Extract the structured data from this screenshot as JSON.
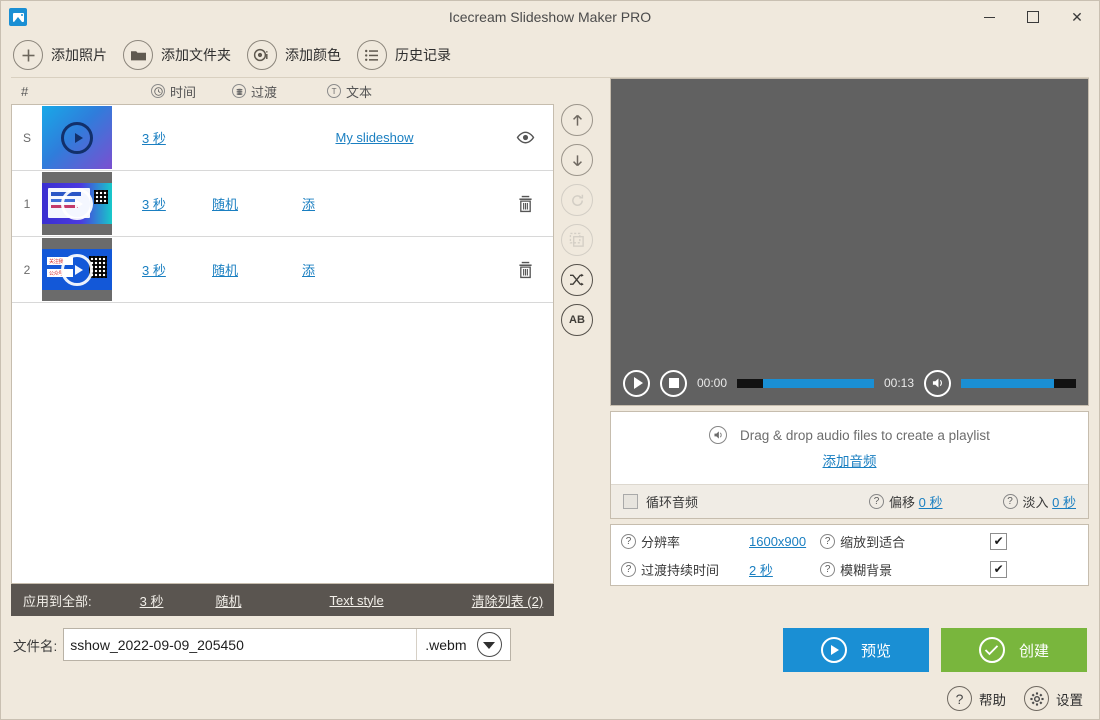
{
  "window": {
    "title": "Icecream Slideshow Maker PRO",
    "app_icon": "picture-icon",
    "minimize": "–",
    "maximize": "□",
    "close": "✕"
  },
  "toolbar": {
    "items": [
      {
        "label": "添加照片",
        "icon": "plus-icon"
      },
      {
        "label": "添加文件夹",
        "icon": "folder-icon"
      },
      {
        "label": "添加颜色",
        "icon": "color-icon"
      },
      {
        "label": "历史记录",
        "icon": "history-list-icon"
      }
    ]
  },
  "list": {
    "headers": {
      "number": "#",
      "time": "时间",
      "time_icon": "clock-icon",
      "transition": "过渡",
      "transition_icon": "transition-icon",
      "text": "文本",
      "text_icon": "text-t-icon"
    },
    "rows": [
      {
        "num": "S",
        "thumb": "gradient-blue-purple",
        "time": "3 秒",
        "transition": "",
        "text": "My slideshow",
        "action": "眼睛",
        "action_icon": "eye-icon"
      },
      {
        "num": "1",
        "thumb": "photo-card-qr",
        "time": "3 秒",
        "transition": "随机",
        "text": "添",
        "action": "删除",
        "action_icon": "trash-icon"
      },
      {
        "num": "2",
        "thumb": "photo-blue-qr",
        "time": "3 秒",
        "transition": "随机",
        "text": "添",
        "action": "删除",
        "action_icon": "trash-icon"
      }
    ]
  },
  "side_tools": [
    {
      "name": "move-up",
      "icon": "arrow-up-icon",
      "state": "enabled"
    },
    {
      "name": "move-down",
      "icon": "arrow-down-icon",
      "state": "enabled"
    },
    {
      "name": "rotate",
      "icon": "rotate-icon",
      "state": "disabled"
    },
    {
      "name": "duplicate",
      "icon": "copy-icon",
      "state": "disabled"
    },
    {
      "name": "shuffle",
      "icon": "shuffle-icon",
      "state": "enabled"
    },
    {
      "name": "sort-ab",
      "icon": "ab-sort-icon",
      "label": "AB",
      "state": "enabled"
    }
  ],
  "apply_all": {
    "label": "应用到全部:",
    "time": "3 秒",
    "transition": "随机",
    "text_style": "Text style",
    "clear_list": "清除列表 (2)"
  },
  "player": {
    "play_icon": "play-icon",
    "stop_icon": "stop-icon",
    "current_time": "00:00",
    "total_time": "00:13",
    "speaker_icon": "speaker-icon",
    "seek_percent": 0,
    "volume_percent": 82
  },
  "audio": {
    "drop_icon": "speaker-icon",
    "drop_text": "Drag & drop audio files to create a playlist",
    "add_audio": "添加音频",
    "loop_label": "循环音频",
    "loop_checked": false,
    "offset_label": "偏移",
    "offset_value": "0 秒",
    "fadein_label": "淡入",
    "fadein_value": "0 秒",
    "help_icon": "question-icon"
  },
  "settings": {
    "resolution_label": "分辨率",
    "resolution_value": "1600x900",
    "transition_duration_label": "过渡持续时间",
    "transition_duration_value": "2 秒",
    "zoom_fit_label": "缩放到适合",
    "zoom_fit_checked": true,
    "blur_bg_label": "模糊背景",
    "blur_bg_checked": true,
    "check_mark": "✔",
    "help_icon": "question-icon"
  },
  "filename": {
    "label": "文件名:",
    "value": "sshow_2022-09-09_205450",
    "placeholder": "sshow",
    "extension": ".webm",
    "dropdown_icon": "chevron-down-icon"
  },
  "actions": {
    "preview": "预览",
    "preview_icon": "play-icon",
    "create": "创建",
    "create_icon": "check-circle-icon",
    "help": "帮助",
    "help_icon": "question-icon",
    "settings": "设置",
    "settings_icon": "gear-icon"
  },
  "colors": {
    "background": "#f0e9dd",
    "accent_blue": "#1a8fd4",
    "accent_green": "#79b63d",
    "link_blue": "#1a7fc1",
    "dark_bar": "#5a5550",
    "preview_gray": "#616161"
  }
}
